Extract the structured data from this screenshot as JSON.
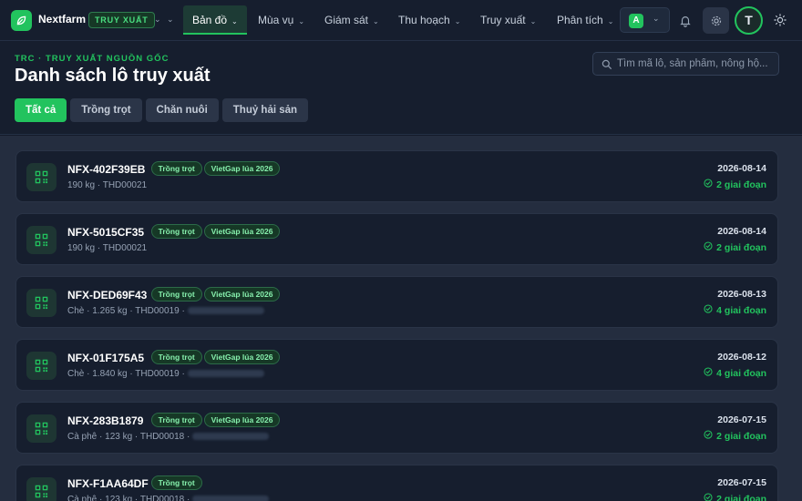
{
  "brand": "Nextfarm",
  "module_badge": "TRUY XUẤT",
  "nav": [
    {
      "label": "Bản đồ",
      "active": true
    },
    {
      "label": "Mùa vụ"
    },
    {
      "label": "Giám sát"
    },
    {
      "label": "Thu hoạch"
    },
    {
      "label": "Truy xuất"
    },
    {
      "label": "Phân tích"
    }
  ],
  "org_initial": "A",
  "user_initial": "T",
  "header": {
    "eyebrow": "TRC · TRUY XUẤT NGUỒN GỐC",
    "title": "Danh sách lô truy xuất",
    "search_placeholder": "Tìm mã lô, sản phẩm, nông hộ..."
  },
  "tabs": [
    {
      "label": "Tất cả",
      "active": true
    },
    {
      "label": "Trồng trọt"
    },
    {
      "label": "Chăn nuôi"
    },
    {
      "label": "Thuỷ hải sản"
    }
  ],
  "batches": [
    {
      "code": "NFX-402F39EB",
      "category": "Trồng trọt",
      "cert": "VietGap lúa 2026",
      "meta": "190 kg · THD00021",
      "date": "2026-08-14",
      "stages": "2 giai đoạn"
    },
    {
      "code": "NFX-5015CF35",
      "category": "Trồng trọt",
      "cert": "VietGap lúa 2026",
      "meta": "190 kg · THD00021",
      "date": "2026-08-14",
      "stages": "2 giai đoạn"
    },
    {
      "code": "NFX-DED69F43",
      "category": "Trồng trọt",
      "cert": "VietGap lúa 2026",
      "meta": "Chè · 1.265 kg · THD00019 ·",
      "date": "2026-08-13",
      "stages": "4 giai đoạn"
    },
    {
      "code": "NFX-01F175A5",
      "category": "Trồng trọt",
      "cert": "VietGap lúa 2026",
      "meta": "Chè · 1.840 kg · THD00019 ·",
      "date": "2026-08-12",
      "stages": "4 giai đoạn"
    },
    {
      "code": "NFX-283B1879",
      "category": "Trồng trọt",
      "cert": "VietGap lúa 2026",
      "meta": "Cà phê · 123 kg · THD00018 ·",
      "date": "2026-07-15",
      "stages": "2 giai đoạn"
    },
    {
      "code": "NFX-F1AA64DF",
      "category": "Trồng trọt",
      "cert": "",
      "meta": "Cà phê · 123 kg · THD00018 ·",
      "date": "2026-07-15",
      "stages": "2 giai đoạn"
    }
  ],
  "colors": {
    "accent": "#22c35e",
    "bg": "#141b2a",
    "card": "#161e2e"
  }
}
